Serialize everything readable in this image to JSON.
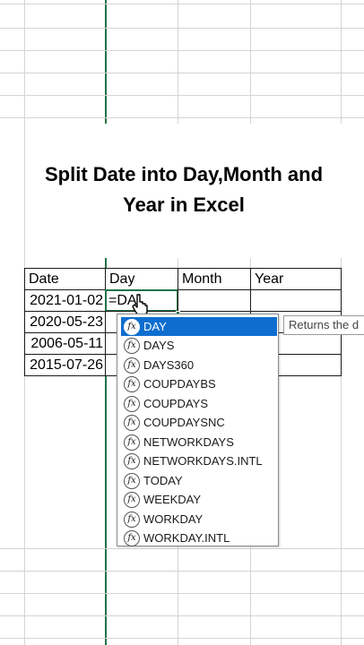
{
  "title": {
    "line1": "Split Date into Day,Month and",
    "line2": "Year in Excel"
  },
  "table": {
    "headers": [
      "Date",
      "Day",
      "Month",
      "Year"
    ],
    "rows": [
      [
        "2021-01-02",
        "=DA",
        "",
        ""
      ],
      [
        "2020-05-23",
        "",
        "",
        ""
      ],
      [
        "2006-05-11",
        "",
        "",
        ""
      ],
      [
        "2015-07-26",
        "",
        "",
        ""
      ]
    ]
  },
  "autocomplete": {
    "icon_glyph": "fx",
    "selected_index": 0,
    "items": [
      "DAY",
      "DAYS",
      "DAYS360",
      "COUPDAYBS",
      "COUPDAYS",
      "COUPDAYSNC",
      "NETWORKDAYS",
      "NETWORKDAYS.INTL",
      "TODAY",
      "WEEKDAY",
      "WORKDAY",
      "WORKDAY.INTL"
    ]
  },
  "tooltip": "Returns the d",
  "colors": {
    "selection_accent": "#217346",
    "dropdown_highlight": "#0e6ecf"
  },
  "icons": {
    "function": "function-fx-icon",
    "cursor": "mouse-pointer-icon"
  }
}
